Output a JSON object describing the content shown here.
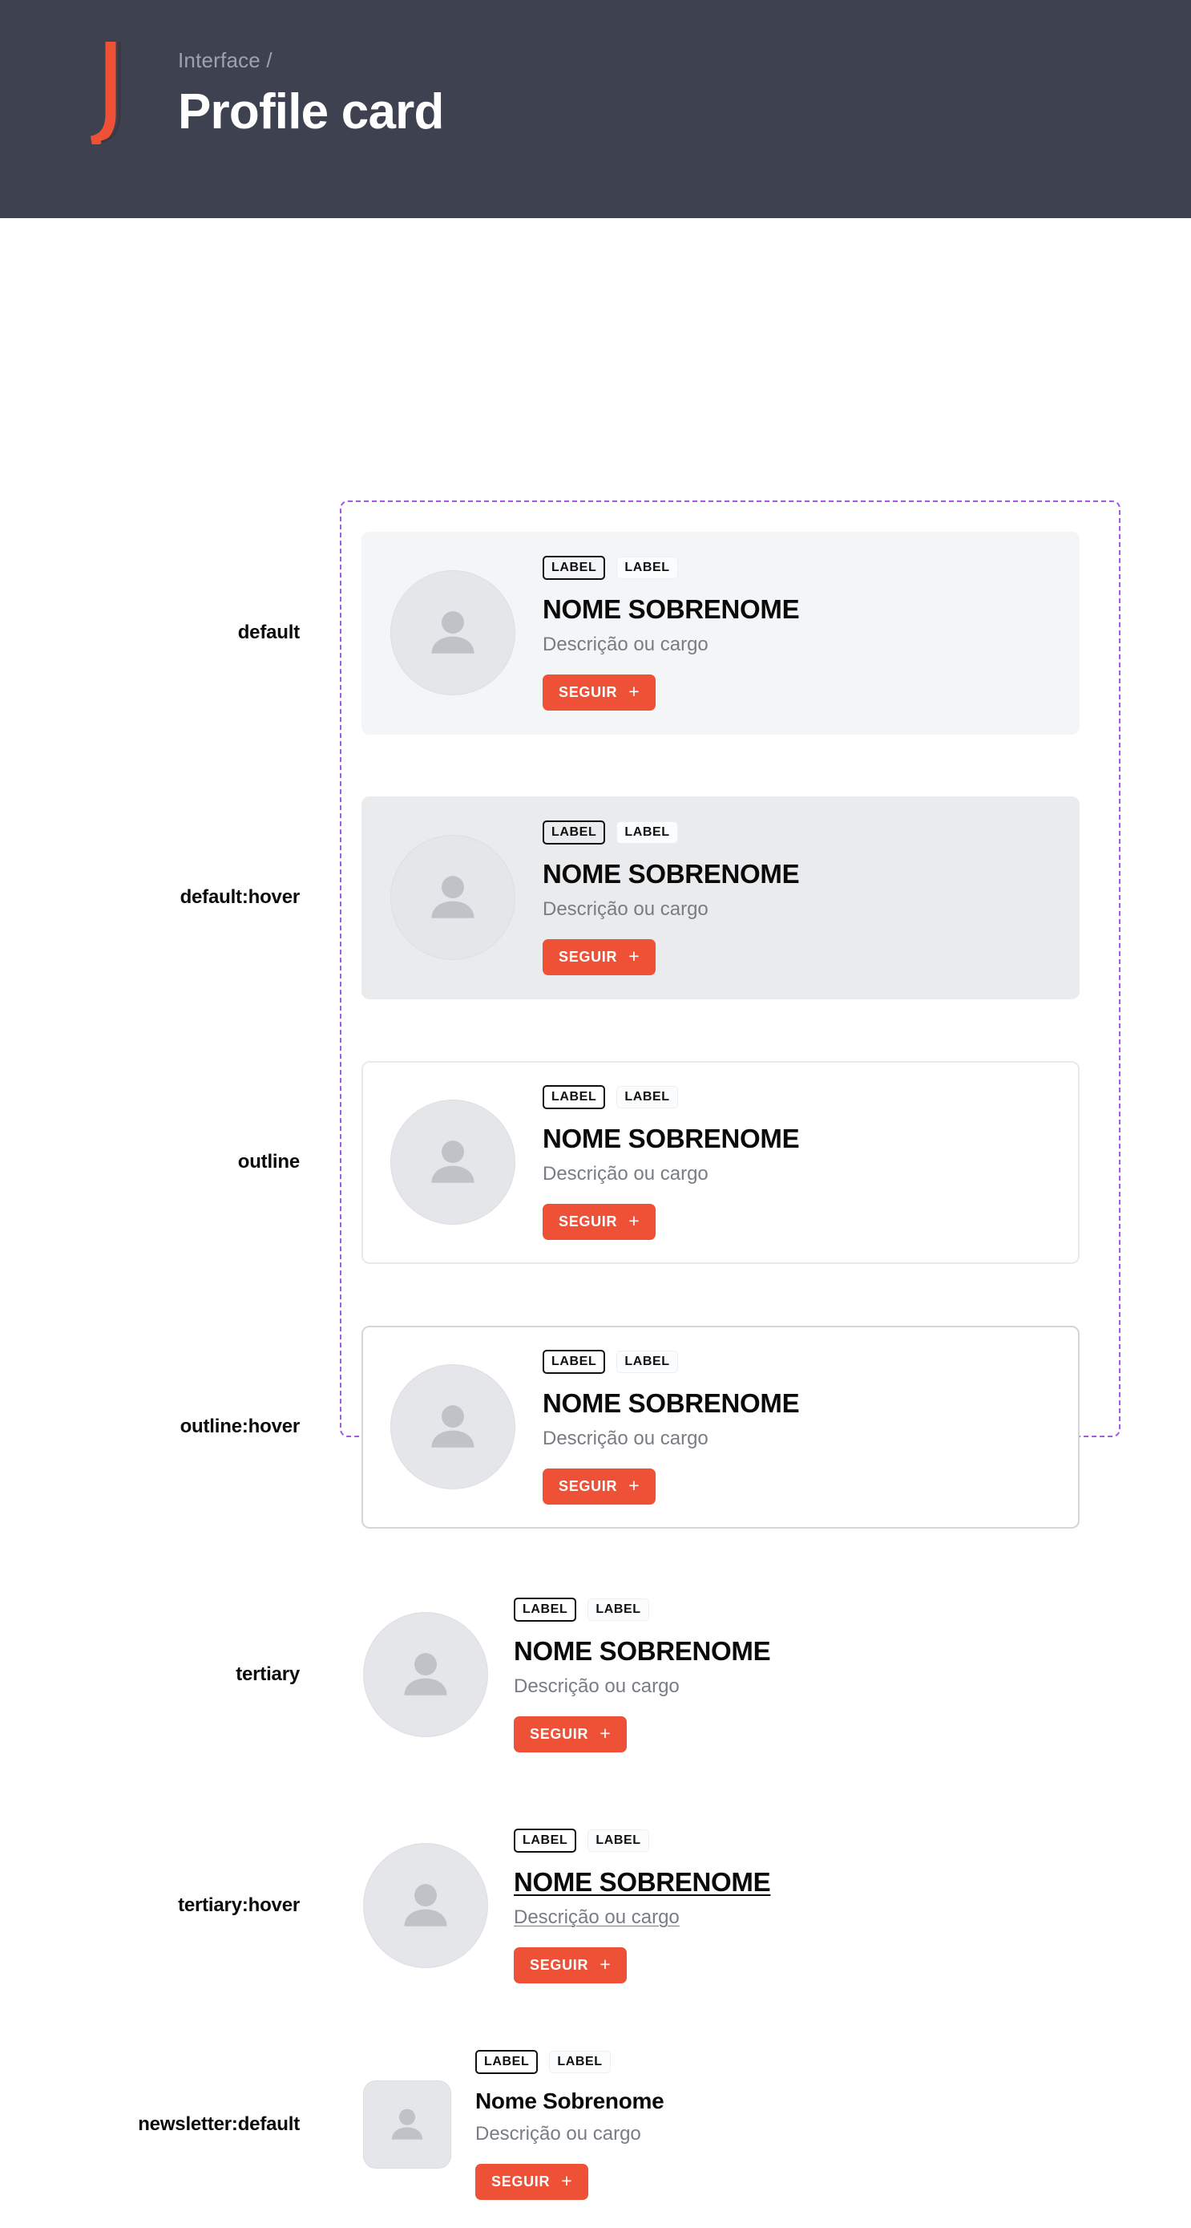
{
  "header": {
    "breadcrumb": "Interface /",
    "title": "Profile card",
    "logo_icon": "letter-j-logo",
    "background_color": "#3e4250",
    "logo_color": "#ef5136",
    "breadcrumb_color": "#9ea2ae"
  },
  "frame": {
    "border_color": "#a259e6",
    "border_style": "dashed"
  },
  "common": {
    "chip_primary": "LABEL",
    "chip_secondary": "LABEL",
    "name_upper": "NOME SOBRENOME",
    "name_title": "Nome Sobrenome",
    "description": "Descrição ou cargo",
    "follow_label": "SEGUIR",
    "follow_plus": "+",
    "avatar_icon": "person-avatar-icon",
    "accent_color": "#ef5136"
  },
  "rows": [
    {
      "state": "default",
      "variant": "v-default",
      "avatar_shape": "circle",
      "name": "NOME SOBRENOME",
      "name_underline": false,
      "desc_underline": false,
      "background_color": "#f4f5f7"
    },
    {
      "state": "default:hover",
      "variant": "v-default-hover",
      "avatar_shape": "circle",
      "name": "NOME SOBRENOME",
      "name_underline": false,
      "desc_underline": false,
      "background_color": "#eaebed"
    },
    {
      "state": "outline",
      "variant": "v-outline",
      "avatar_shape": "circle",
      "name": "NOME SOBRENOME",
      "name_underline": false,
      "desc_underline": false,
      "background_color": "#ffffff",
      "border_color": "#e9eaec"
    },
    {
      "state": "outline:hover",
      "variant": "v-outline-hover",
      "avatar_shape": "circle",
      "name": "NOME SOBRENOME",
      "name_underline": false,
      "desc_underline": false,
      "background_color": "#ffffff",
      "border_color": "#d3d5d9"
    },
    {
      "state": "tertiary",
      "variant": "v-tertiary",
      "avatar_shape": "circle",
      "name": "NOME SOBRENOME",
      "name_underline": false,
      "desc_underline": false,
      "background_color": "transparent"
    },
    {
      "state": "tertiary:hover",
      "variant": "v-tertiary-hover",
      "avatar_shape": "circle",
      "name": "NOME SOBRENOME",
      "name_underline": true,
      "desc_underline": true,
      "background_color": "transparent"
    },
    {
      "state": "newsletter:default",
      "variant": "v-newsletter",
      "avatar_shape": "rounded-square",
      "name": "Nome Sobrenome",
      "name_underline": false,
      "desc_underline": false,
      "background_color": "transparent"
    }
  ]
}
